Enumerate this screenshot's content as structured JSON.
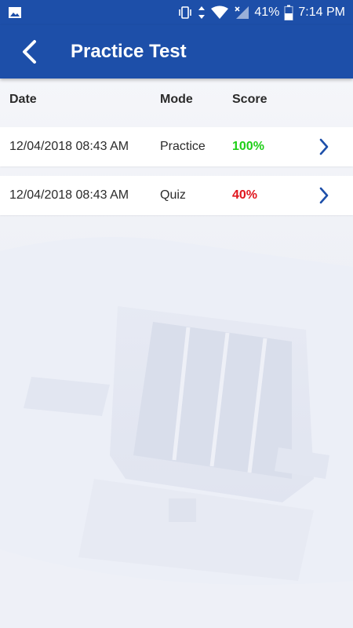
{
  "status_bar": {
    "battery_percent": "41%",
    "time": "7:14 PM"
  },
  "app_bar": {
    "title": "Practice Test",
    "back_icon": "chevron-left-icon"
  },
  "table": {
    "headers": {
      "date": "Date",
      "mode": "Mode",
      "score": "Score"
    },
    "rows": [
      {
        "date": "12/04/2018 08:43 AM",
        "mode": "Practice",
        "score": "100%",
        "score_color": "#1ecf17"
      },
      {
        "date": "12/04/2018 08:43 AM",
        "mode": "Quiz",
        "score": "40%",
        "score_color": "#e0141c"
      }
    ]
  },
  "colors": {
    "brand": "#1d4fa9",
    "chevron": "#1d4fa9",
    "pass": "#1ecf17",
    "fail": "#e0141c"
  }
}
